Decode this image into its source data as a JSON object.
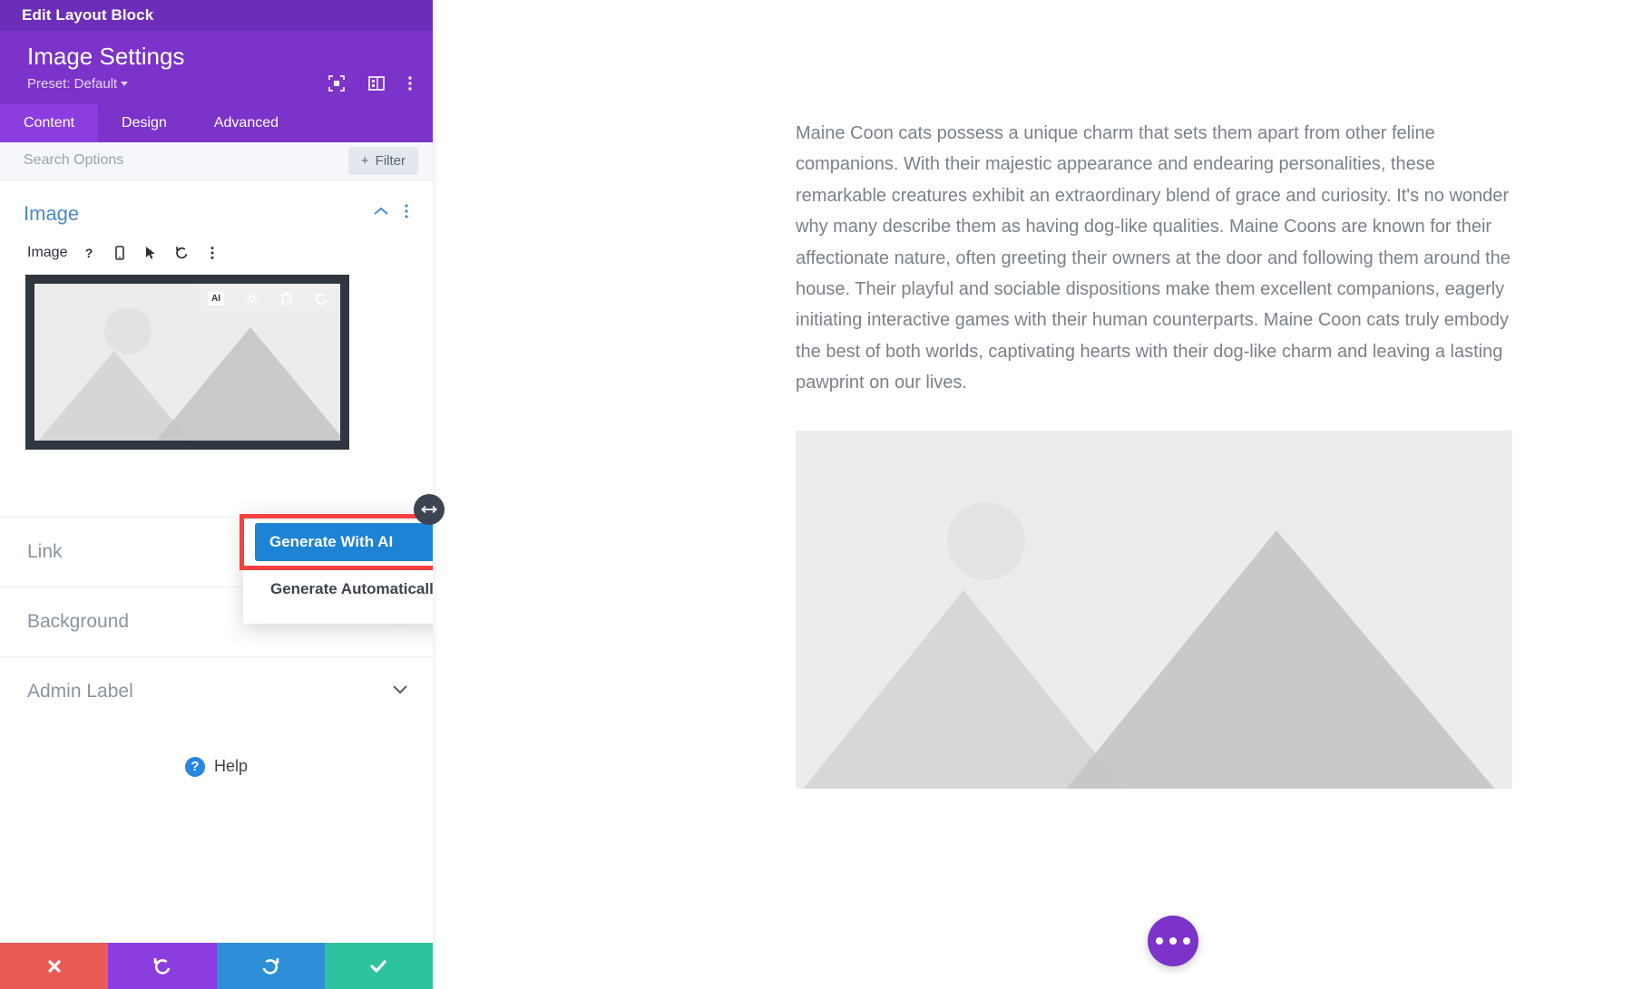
{
  "window": {
    "title": "Edit Layout Block"
  },
  "panel": {
    "heading": "Image Settings",
    "preset_label": "Preset: Default",
    "head_icons": [
      {
        "name": "focus-target-icon"
      },
      {
        "name": "panel-layout-icon"
      },
      {
        "name": "more-vertical-icon"
      }
    ],
    "tabs": [
      {
        "label": "Content",
        "active": true
      },
      {
        "label": "Design",
        "active": false
      },
      {
        "label": "Advanced",
        "active": false
      }
    ],
    "search": {
      "value": "",
      "placeholder": "Search Options"
    },
    "filter_label": "Filter",
    "section": {
      "title": "Image",
      "collapse_icon": "chevron-up-icon",
      "menu_icon": "more-vertical-icon"
    },
    "field": {
      "label": "Image",
      "icons": [
        {
          "name": "help-icon",
          "glyph": "?"
        },
        {
          "name": "responsive-device-icon"
        },
        {
          "name": "hover-cursor-icon"
        },
        {
          "name": "reset-icon"
        },
        {
          "name": "more-vertical-icon"
        }
      ]
    },
    "image_toolbar": [
      {
        "name": "ai-badge-icon",
        "label": "AI"
      },
      {
        "name": "settings-gear-icon"
      },
      {
        "name": "trash-icon"
      },
      {
        "name": "undo-icon"
      }
    ],
    "ai_menu": {
      "primary_label": "Generate With AI",
      "secondary_label": "Generate Automatically",
      "highlight_color": "#f6403f",
      "primary_color": "#1d83d4"
    },
    "accordions": [
      {
        "label": "Link",
        "icon": "chevron-down-icon"
      },
      {
        "label": "Background",
        "icon": "chevron-down-icon"
      },
      {
        "label": "Admin Label",
        "icon": "chevron-down-icon"
      }
    ],
    "help": {
      "label": "Help",
      "icon": "help-circle-icon"
    },
    "actions": [
      {
        "name": "cancel-button",
        "icon": "close-icon",
        "color": "#eb5b56"
      },
      {
        "name": "undo-button",
        "icon": "undo-icon",
        "color": "#8c3de0"
      },
      {
        "name": "redo-button",
        "icon": "redo-icon",
        "color": "#2e8fd8"
      },
      {
        "name": "save-button",
        "icon": "check-icon",
        "color": "#2cc39e"
      }
    ],
    "resize_handle": {
      "icon": "horizontal-resize-icon"
    }
  },
  "content": {
    "paragraph": "Maine Coon cats possess a unique charm that sets them apart from other feline companions. With their majestic appearance and endearing personalities, these remarkable creatures exhibit an extraordinary blend of grace and curiosity. It's no wonder why many describe them as having dog-like qualities. Maine Coons are known for their affectionate nature, often greeting their owners at the door and following them around the house. Their playful and sociable dispositions make them excellent companions, eagerly initiating interactive games with their human counterparts. Maine Coon cats truly embody the best of both worlds, captivating hearts with their dog-like charm and leaving a lasting pawprint on our lives.",
    "hero_image": {
      "name": "image-placeholder",
      "alt": "placeholder mountains and sun"
    },
    "fab": {
      "name": "page-settings-fab",
      "icon": "ellipsis-icon"
    }
  },
  "colors": {
    "titlebar": "#6c2eb9",
    "panel_header": "#7b33c9",
    "tab_active": "#8c3de0",
    "section_title": "#4c89c8",
    "thumb_frame": "#2f3640"
  }
}
